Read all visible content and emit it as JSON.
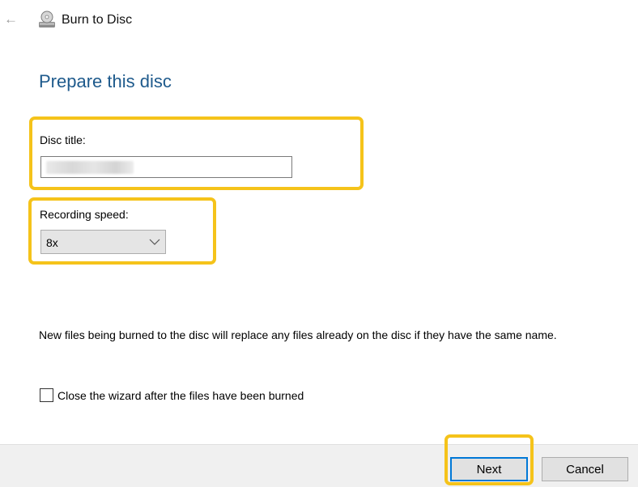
{
  "window": {
    "title": "Burn to Disc",
    "back_icon": "back-arrow-icon",
    "app_icon": "disc-burner-icon"
  },
  "page": {
    "heading": "Prepare this disc"
  },
  "disc_title": {
    "label": "Disc title:",
    "value": ""
  },
  "recording_speed": {
    "label": "Recording speed:",
    "selected": "8x"
  },
  "info": {
    "text": "New files being burned to the disc will replace any files already on the disc if they have the same name."
  },
  "close_wizard": {
    "label": "Close the wizard after the files have been burned",
    "checked": false
  },
  "buttons": {
    "next": "Next",
    "cancel": "Cancel"
  },
  "colors": {
    "heading": "#1e5a8c",
    "highlight": "#f5c31a",
    "focus_border": "#0078d7"
  }
}
